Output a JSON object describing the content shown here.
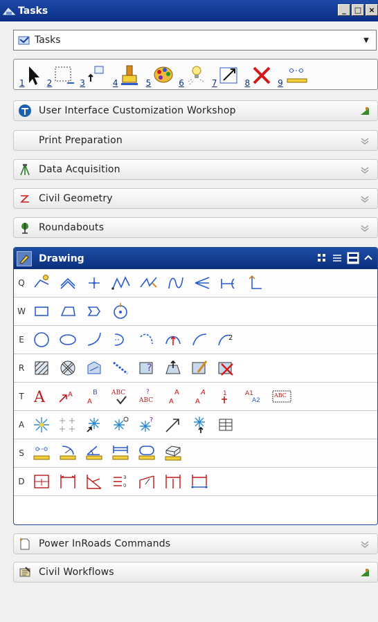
{
  "window": {
    "title": "Tasks",
    "min_glyph": "_",
    "max_glyph": "□",
    "close_glyph": "×"
  },
  "combo": {
    "value": "Tasks",
    "arrow": "▼"
  },
  "toolbar": {
    "buttons": [
      {
        "num": "1",
        "icon": "select-arrow-icon"
      },
      {
        "num": "2",
        "icon": "fence-icon"
      },
      {
        "num": "3",
        "icon": "move-icon"
      },
      {
        "num": "4",
        "icon": "paint-icon"
      },
      {
        "num": "5",
        "icon": "palette-icon"
      },
      {
        "num": "6",
        "icon": "light-icon"
      },
      {
        "num": "7",
        "icon": "scale-icon"
      },
      {
        "num": "8",
        "icon": "delete-icon"
      },
      {
        "num": "9",
        "icon": "measure-icon"
      }
    ]
  },
  "sections_top": [
    {
      "label": "User Interface Customization Workshop",
      "icon": "workshop-icon",
      "action": "pin-icon"
    },
    {
      "label": "Print Preparation",
      "icon": "",
      "action": "chevron-down-icon"
    },
    {
      "label": "Data Acquisition",
      "icon": "survey-icon",
      "action": "chevron-down-icon"
    },
    {
      "label": "Civil Geometry",
      "icon": "geometry-icon",
      "action": "chevron-down-icon"
    },
    {
      "label": "Roundabouts",
      "icon": "roundabout-icon",
      "action": "chevron-down-icon"
    }
  ],
  "drawing": {
    "label": "Drawing",
    "rows": [
      {
        "key": "Q",
        "count": 10
      },
      {
        "key": "W",
        "count": 4
      },
      {
        "key": "E",
        "count": 8
      },
      {
        "key": "R",
        "count": 8
      },
      {
        "key": "T",
        "count": 10
      },
      {
        "key": "A",
        "count": 8
      },
      {
        "key": "S",
        "count": 6
      },
      {
        "key": "D",
        "count": 7
      }
    ]
  },
  "sections_bottom": [
    {
      "label": "Power InRoads Commands",
      "icon": "new-doc-icon",
      "action": "chevron-down-icon"
    },
    {
      "label": "Civil Workflows",
      "icon": "workflow-icon",
      "action": "pin-icon"
    }
  ],
  "colors": {
    "title_bar": "#0a2e86",
    "accent_red": "#d21a1a",
    "tool_blue": "#2a5bd0"
  }
}
